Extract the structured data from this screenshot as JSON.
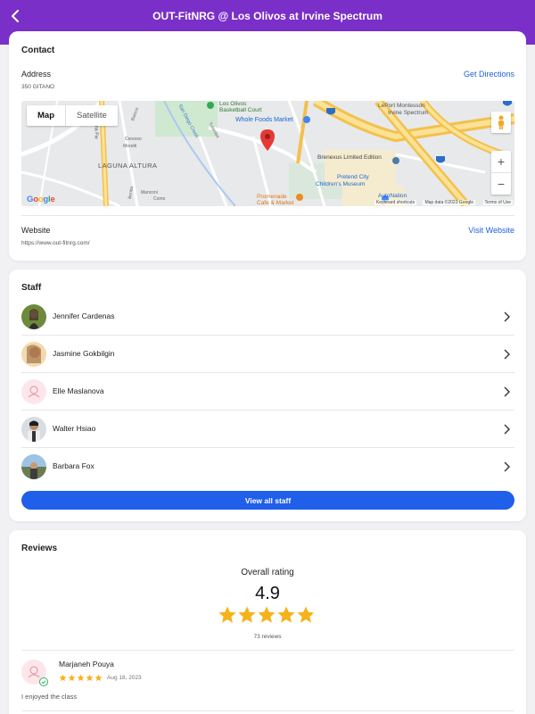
{
  "header": {
    "title": "OUT-FitNRG @ Los Olivos at Irvine Spectrum"
  },
  "contact": {
    "title": "Contact",
    "address_label": "Address",
    "address_value": "350 GITANO",
    "get_directions": "Get Directions",
    "website_label": "Website",
    "website_value": "https://www.out-fitnrg.com/",
    "visit_website": "Visit Website"
  },
  "map": {
    "toggle_map": "Map",
    "toggle_satellite": "Satellite",
    "zoom_in": "+",
    "zoom_out": "−",
    "labels": {
      "los_olivos": "Los Olivos",
      "basketball": "Basketball Court",
      "whole_foods": "Whole Foods Market",
      "lepont": "LePort Montessori",
      "irvine_spectrum": "Irvine Spectrum",
      "laguna_altura": "LAGUNA ALTURA",
      "brenexus": "Brenexus Limited Edition",
      "pretend_city": "Pretend City",
      "childrens_museum": "Children's Museum",
      "promenade": "Promenade",
      "cafe_market": "Cafe & Market",
      "autonation": "AutoNation",
      "san_diego_creek": "San Diego Creek",
      "laguna_fwy": "Laguna Fw",
      "bianco": "Bianco",
      "ceresso": "Ceresso",
      "moretti": "Moretti",
      "manconi": "Manconi",
      "como": "Como",
      "bonita": "Bonita",
      "tulare": "Tularosa"
    },
    "footer_shortcuts": "Keyboard shortcuts",
    "footer_data": "Map data ©2023 Google",
    "footer_terms": "Terms of Use",
    "google": "Google"
  },
  "staff": {
    "title": "Staff",
    "members": [
      {
        "name": "Jennifer Cardenas"
      },
      {
        "name": "Jasmine Gokbilgin"
      },
      {
        "name": "Elle Maslanova"
      },
      {
        "name": "Walter Hsiao"
      },
      {
        "name": "Barbara Fox"
      }
    ],
    "view_all": "View all staff"
  },
  "reviews": {
    "title": "Reviews",
    "overall_label": "Overall rating",
    "overall_value": "4.9",
    "overall_stars": 4.9,
    "count": "73 reviews",
    "items": [
      {
        "author": "Marjaneh Pouya",
        "date": "Aug 18, 2023",
        "stars": 5,
        "text": "I enjoyed the class"
      }
    ]
  },
  "colors": {
    "header": "#7a2fc9",
    "link": "#1e5fe0",
    "primary_button": "#1f5fea",
    "star": "#f6b21b"
  }
}
